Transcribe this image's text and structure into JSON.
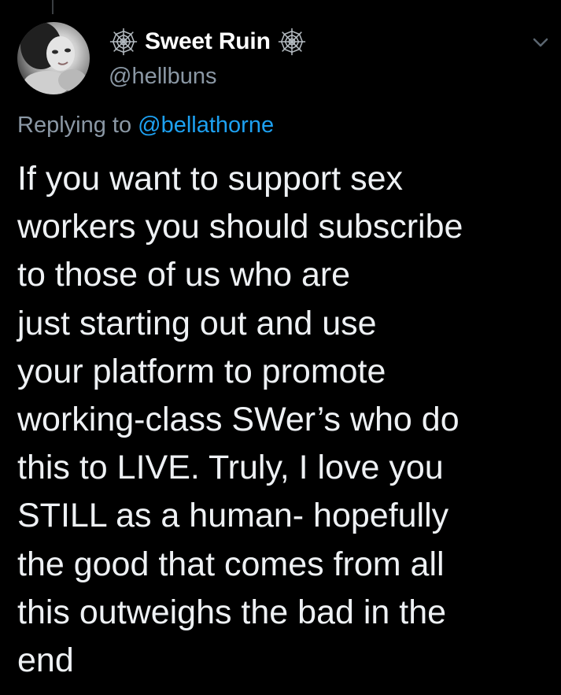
{
  "colors": {
    "background": "#000000",
    "text": "#eef1f4",
    "muted": "#8b98a5",
    "link": "#1da1f2"
  },
  "author": {
    "display_name": "Sweet Ruin",
    "handle": "@hellbuns",
    "name_icons": [
      "spider-web-icon",
      "spider-web-icon"
    ]
  },
  "reply": {
    "prefix": "Replying to",
    "mention": "@bellathorne"
  },
  "tweet": {
    "lines": [
      "If you want to support sex",
      "workers you should subscribe",
      "to those of us who are",
      "just starting out and use",
      "your platform to promote",
      "working-class SWer’s who do",
      "this to LIVE. Truly, I love you",
      "STILL as a human- hopefully",
      "the good that comes from all",
      "this outweighs the bad in the",
      "end"
    ]
  },
  "menu_icon": "chevron-down-icon"
}
